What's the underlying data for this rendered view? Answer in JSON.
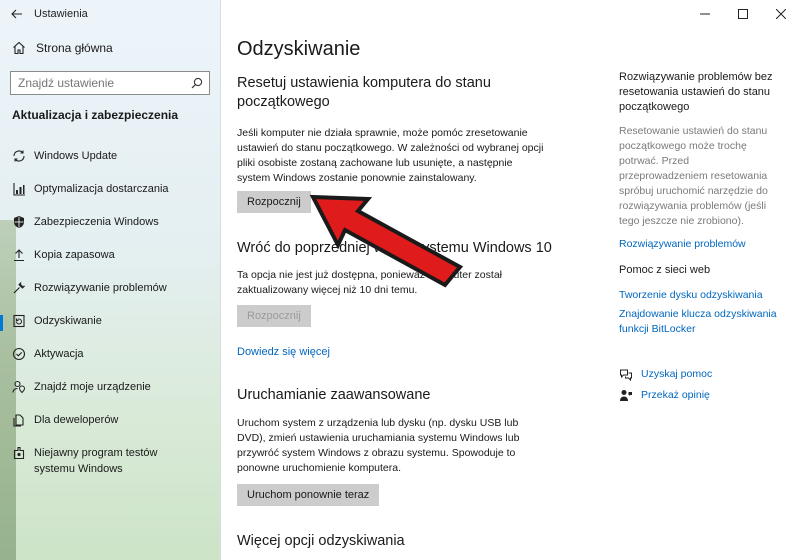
{
  "window": {
    "title": "Ustawienia"
  },
  "sidebar": {
    "home_label": "Strona główna",
    "search_placeholder": "Znajdź ustawienie",
    "section_title": "Aktualizacja i zabezpieczenia",
    "items": [
      {
        "label": "Windows Update",
        "icon": "sync-icon"
      },
      {
        "label": "Optymalizacja dostarczania",
        "icon": "delivery-optimization-icon"
      },
      {
        "label": "Zabezpieczenia Windows",
        "icon": "shield-icon"
      },
      {
        "label": "Kopia zapasowa",
        "icon": "upload-icon"
      },
      {
        "label": "Rozwiązywanie problemów",
        "icon": "wrench-icon"
      },
      {
        "label": "Odzyskiwanie",
        "icon": "recovery-icon",
        "active": true
      },
      {
        "label": "Aktywacja",
        "icon": "check-circle-icon"
      },
      {
        "label": "Znajdź moje urządzenie",
        "icon": "person-location-icon"
      },
      {
        "label": "Dla deweloperów",
        "icon": "developer-icon"
      },
      {
        "label": "Niejawny program testów systemu Windows",
        "icon": "insider-icon"
      }
    ]
  },
  "main": {
    "title": "Odzyskiwanie",
    "reset": {
      "heading": "Resetuj ustawienia komputera do stanu początkowego",
      "text": "Jeśli komputer nie działa sprawnie, może pomóc zresetowanie ustawień do stanu początkowego. W zależności od wybranej opcji pliki osobiste zostaną zachowane lub usunięte, a następnie system Windows zostanie ponownie zainstalowany.",
      "button": "Rozpocznij"
    },
    "goback": {
      "heading": "Wróć do poprzedniej wersji systemu Windows 10",
      "text": "Ta opcja nie jest już dostępna, ponieważ komputer został zaktualizowany więcej niż 10 dni temu.",
      "button": "Rozpocznij",
      "link": "Dowiedz się więcej"
    },
    "advanced": {
      "heading": "Uruchamianie zaawansowane",
      "text": "Uruchom system z urządzenia lub dysku (np. dysku USB lub DVD), zmień ustawienia uruchamiania systemu Windows lub przywróć system Windows z obrazu systemu. Spowoduje to ponowne uruchomienie komputera.",
      "button": "Uruchom ponownie teraz"
    },
    "more": {
      "heading": "Więcej opcji odzyskiwania"
    }
  },
  "right": {
    "troubleshoot": {
      "heading": "Rozwiązywanie problemów bez resetowania ustawień do stanu początkowego",
      "text": "Resetowanie ustawień do stanu początkowego może trochę potrwać. Przed przeprowadzeniem resetowania spróbuj uruchomić narzędzie do rozwiązywania problemów (jeśli tego jeszcze nie zrobiono).",
      "link": "Rozwiązywanie problemów"
    },
    "web_help": {
      "heading": "Pomoc z sieci web",
      "links": [
        "Tworzenie dysku odzyskiwania",
        "Znajdowanie klucza odzyskiwania funkcji BitLocker"
      ]
    },
    "get_help": "Uzyskaj pomoc",
    "feedback": "Przekaż opinię"
  },
  "colors": {
    "accent": "#0067c0",
    "arrow": "#e01b1b",
    "button": "#cccccc"
  }
}
